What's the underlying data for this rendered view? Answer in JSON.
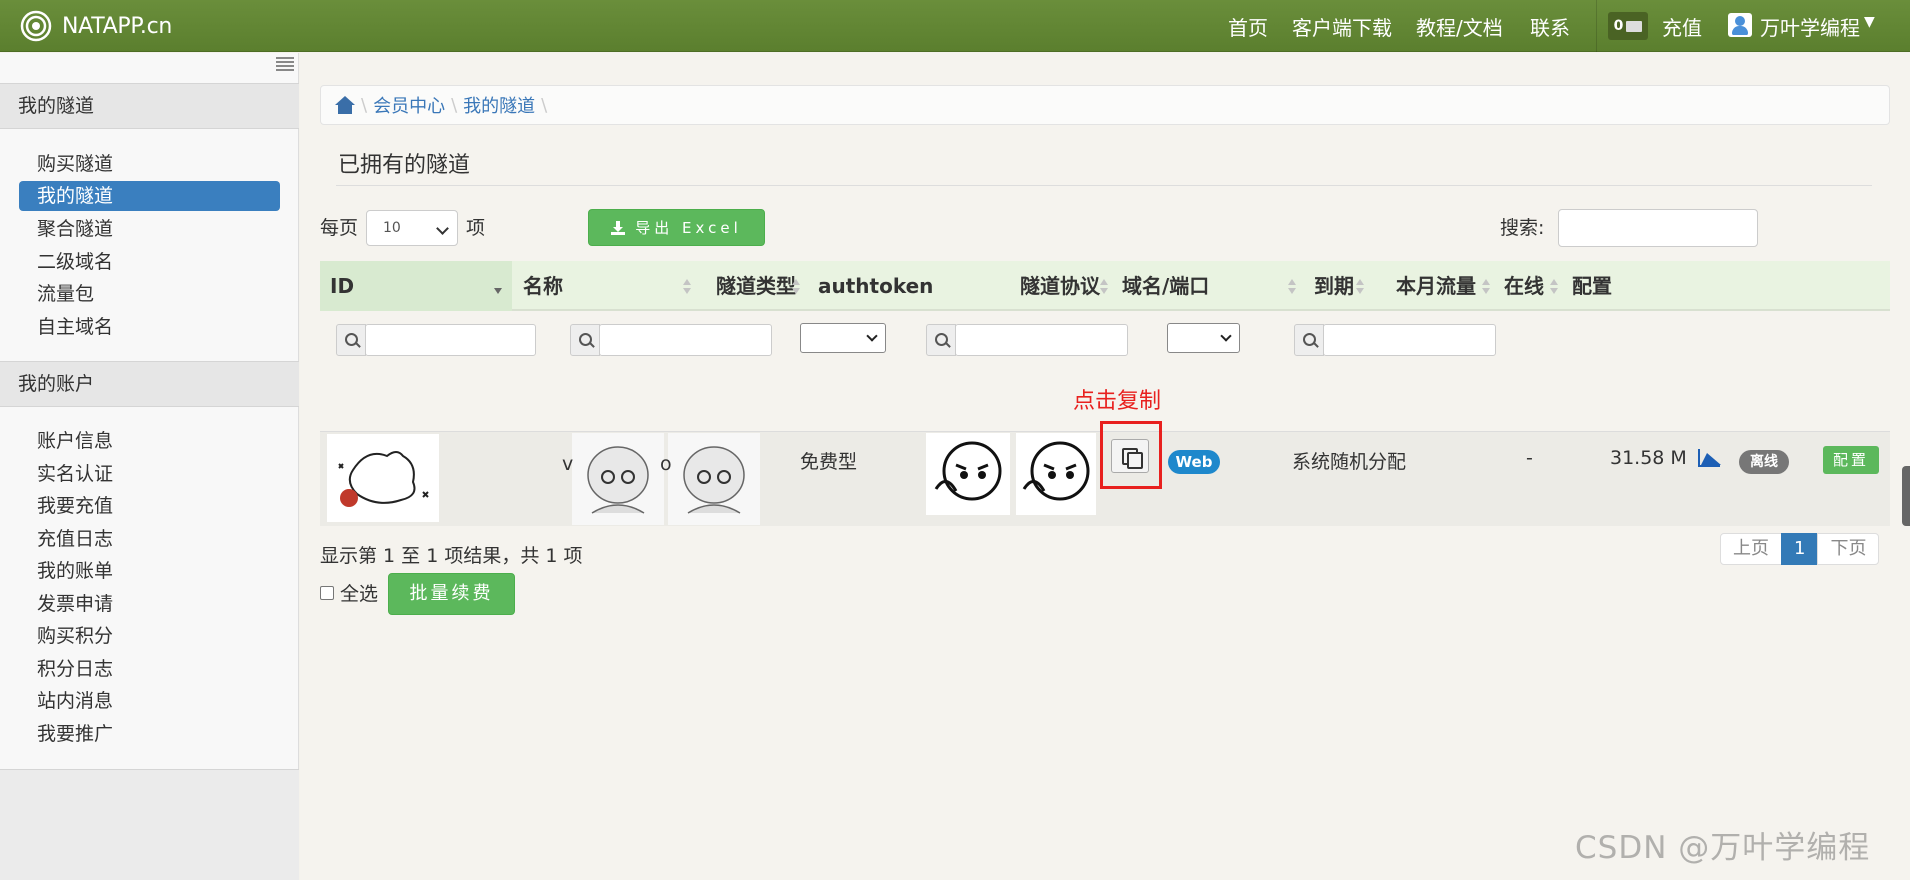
{
  "navbar": {
    "brand": "NATAPP.cn",
    "links": [
      "首页",
      "客户端下载",
      "教程/文档",
      "联系"
    ],
    "mail_count": "0",
    "recharge": "充值",
    "user": "万叶学编程"
  },
  "sidebar": {
    "section1_title": "我的隧道",
    "section1_items": [
      "购买隧道",
      "我的隧道",
      "聚合隧道",
      "二级域名",
      "流量包",
      "自主域名"
    ],
    "section2_title": "我的账户",
    "section2_items": [
      "账户信息",
      "实名认证",
      "我要充值",
      "充值日志",
      "我的账单",
      "发票申请",
      "购买积分",
      "积分日志",
      "站内消息",
      "我要推广"
    ]
  },
  "breadcrumb": [
    "会员中心",
    "我的隧道"
  ],
  "page_title": "已拥有的隧道",
  "controls": {
    "per_page_label": "每页",
    "per_page_value": "10",
    "per_page_suffix": "项",
    "export_label": "导出 Excel",
    "search_label": "搜索:",
    "search_value": ""
  },
  "table": {
    "headers": [
      "ID",
      "名称",
      "隧道类型",
      "authtoken",
      "隧道协议",
      "域名/端口",
      "到期",
      "本月流量",
      "在线",
      "配置"
    ],
    "row": {
      "name_fragment_left": "v",
      "name_fragment_right": "o",
      "type": "免费型",
      "protocol": "Web",
      "domain": "系统随机分配",
      "expire": "-",
      "traffic": "31.58 M",
      "online": "离线",
      "config": "配置"
    }
  },
  "annotation": "点击复制",
  "footer": {
    "info": "显示第 1 至 1 项结果，共 1 项",
    "select_all": "全选",
    "renew": "批量续费"
  },
  "pager": {
    "prev": "上页",
    "current": "1",
    "next": "下页"
  },
  "watermark": "CSDN @万叶学编程",
  "colors": {
    "navbar": "#5b7f2e",
    "active_sidebar": "#3a7fbf",
    "button_green": "#5cb85c",
    "annotation_red": "#e8201e",
    "badge_web": "#1e88cc"
  }
}
